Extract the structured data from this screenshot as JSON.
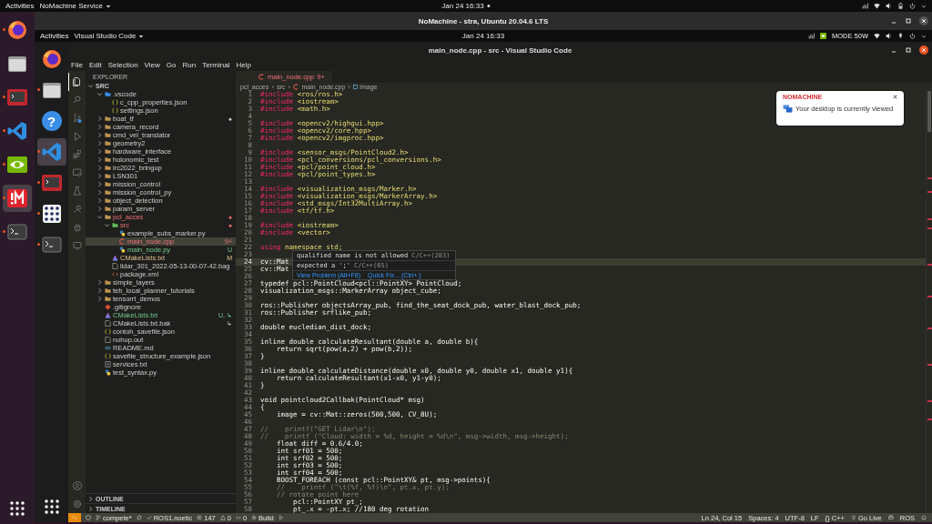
{
  "desktop": {
    "top_bar": {
      "activities": "Activities",
      "app_menu": "NoMachine Service",
      "clock": "Jan 24  16:33"
    },
    "dock": [
      {
        "kind": "browser",
        "running": true,
        "focused": false
      },
      {
        "kind": "files",
        "running": false,
        "focused": false
      },
      {
        "kind": "remote-terminal",
        "running": true,
        "focused": false
      },
      {
        "kind": "editor",
        "running": true,
        "focused": false
      },
      {
        "kind": "gpu",
        "running": true,
        "focused": false
      },
      {
        "kind": "remote",
        "running": true,
        "focused": true
      },
      {
        "kind": "terminal",
        "running": true,
        "focused": false
      }
    ],
    "apps_button": {
      "kind": "apps"
    }
  },
  "nomachine": {
    "title": "NoMachine - stra, Ubuntu 20.04.6 LTS"
  },
  "remote_desktop": {
    "top_bar": {
      "activities": "Activities",
      "app_menu": "Visual Studio Code",
      "clock": "Jan 24  16:33",
      "power_mode": "MODE 50W"
    },
    "dock": [
      {
        "kind": "browser",
        "running": false,
        "focused": false
      },
      {
        "kind": "files",
        "running": true,
        "focused": false
      },
      {
        "kind": "help",
        "glyph": "?",
        "running": false,
        "focused": false
      },
      {
        "kind": "editor",
        "running": true,
        "focused": true
      },
      {
        "kind": "remote-terminal",
        "running": true,
        "focused": false
      },
      {
        "kind": "grid",
        "running": true,
        "focused": false
      },
      {
        "kind": "terminal",
        "running": true,
        "focused": false
      }
    ],
    "apps_button": {
      "kind": "apps"
    }
  },
  "vscode": {
    "title": "main_node.cpp - src - Visual Studio Code",
    "menu": [
      "File",
      "Edit",
      "Selection",
      "View",
      "Go",
      "Run",
      "Terminal",
      "Help"
    ],
    "activity_bar": [
      {
        "kind": "files",
        "selected": true
      },
      {
        "kind": "search",
        "selected": false
      },
      {
        "kind": "source-control",
        "selected": false
      },
      {
        "kind": "run",
        "selected": false
      },
      {
        "kind": "extensions",
        "selected": false
      },
      {
        "kind": "remote",
        "selected": false
      },
      {
        "kind": "testing",
        "selected": false
      },
      {
        "kind": "deploy",
        "selected": false
      },
      {
        "kind": "ros",
        "selected": false
      },
      {
        "kind": "monitor",
        "selected": false
      }
    ],
    "activity_bottom": [
      {
        "kind": "account"
      },
      {
        "kind": "settings"
      }
    ],
    "explorer": {
      "title": "EXPLORER",
      "root": {
        "label": "SRC",
        "expanded": true
      },
      "tree": [
        {
          "label": ".vscode",
          "kind": "vscode",
          "expanded": true,
          "error": false,
          "untracked": false,
          "modified": false,
          "selected": false,
          "children": [
            {
              "label": "c_cpp_properties.json",
              "kind": "json",
              "error": false,
              "untracked": false,
              "modified": false,
              "selected": false
            },
            {
              "label": "settings.json",
              "kind": "json",
              "error": false,
              "untracked": false,
              "modified": false,
              "selected": false
            }
          ]
        },
        {
          "label": "boat_tf",
          "kind": "folder",
          "expanded": false,
          "error": false,
          "untracked": false,
          "modified": false,
          "badge": "●",
          "selected": false
        },
        {
          "label": "camera_record",
          "kind": "folder",
          "expanded": false,
          "error": false,
          "untracked": false,
          "modified": false,
          "selected": false
        },
        {
          "label": "cmd_vel_translator",
          "kind": "folder",
          "expanded": false,
          "error": false,
          "untracked": false,
          "modified": false,
          "selected": false
        },
        {
          "label": "geometry2",
          "kind": "folder",
          "expanded": false,
          "error": false,
          "untracked": false,
          "modified": false,
          "selected": false
        },
        {
          "label": "hardware_interface",
          "kind": "folder",
          "expanded": false,
          "error": false,
          "untracked": false,
          "modified": false,
          "selected": false
        },
        {
          "label": "holonomic_test",
          "kind": "folder",
          "expanded": false,
          "error": false,
          "untracked": false,
          "modified": false,
          "selected": false
        },
        {
          "label": "irc2022_bringup",
          "kind": "folder",
          "expanded": false,
          "error": false,
          "untracked": false,
          "modified": false,
          "selected": false
        },
        {
          "label": "LSN301",
          "kind": "folder",
          "expanded": false,
          "error": false,
          "untracked": false,
          "modified": false,
          "selected": false
        },
        {
          "label": "mission_control",
          "kind": "folder",
          "expanded": false,
          "error": false,
          "untracked": false,
          "modified": false,
          "selected": false
        },
        {
          "label": "mission_control_py",
          "kind": "folder",
          "expanded": false,
          "error": false,
          "untracked": false,
          "modified": false,
          "selected": false
        },
        {
          "label": "object_detection",
          "kind": "folder",
          "expanded": false,
          "error": false,
          "untracked": false,
          "modified": false,
          "selected": false
        },
        {
          "label": "param_server",
          "kind": "folder",
          "expanded": false,
          "error": false,
          "untracked": false,
          "modified": false,
          "selected": false
        },
        {
          "label": "pcl_acces",
          "kind": "folder",
          "expanded": true,
          "error": true,
          "untracked": false,
          "modified": false,
          "badge": "●",
          "selected": false,
          "children": [
            {
              "label": "src",
              "kind": "src",
              "expanded": true,
              "error": true,
              "untracked": false,
              "modified": false,
              "badge": "●",
              "selected": false,
              "children": [
                {
                  "label": "example_subs_marker.py",
                  "kind": "py",
                  "error": false,
                  "untracked": false,
                  "modified": false,
                  "selected": false
                },
                {
                  "label": "main_node.cpp",
                  "kind": "cpp",
                  "error": true,
                  "untracked": false,
                  "modified": false,
                  "badge": "9+",
                  "selected": true
                },
                {
                  "label": "main_node.py",
                  "kind": "py",
                  "error": false,
                  "untracked": true,
                  "modified": false,
                  "badge": "U",
                  "selected": false
                }
              ]
            },
            {
              "label": "CMakeLists.txt",
              "kind": "cmake",
              "error": false,
              "untracked": false,
              "modified": true,
              "badge": "M",
              "selected": false
            },
            {
              "label": "lidar_301_2022-05-13-00-07-42.bag",
              "kind": "file",
              "error": false,
              "untracked": false,
              "modified": false,
              "selected": false
            },
            {
              "label": "package.xml",
              "kind": "xml",
              "error": false,
              "untracked": false,
              "modified": false,
              "selected": false
            }
          ]
        },
        {
          "label": "simple_layers",
          "kind": "folder",
          "expanded": false,
          "error": false,
          "untracked": false,
          "modified": false,
          "selected": false
        },
        {
          "label": "teb_local_planner_tutorials",
          "kind": "folder",
          "expanded": false,
          "error": false,
          "untracked": false,
          "modified": false,
          "selected": false
        },
        {
          "label": "tensorrt_demos",
          "kind": "folder",
          "expanded": false,
          "error": false,
          "untracked": false,
          "modified": false,
          "selected": false
        },
        {
          "label": ".gitignore",
          "kind": "git",
          "error": false,
          "untracked": false,
          "modified": false,
          "selected": false
        },
        {
          "label": "CMakeLists.txt",
          "kind": "cmake",
          "error": false,
          "untracked": true,
          "modified": false,
          "badge": "U, ↳",
          "selected": false
        },
        {
          "label": "CMakeLists.txt.bak",
          "kind": "file",
          "error": false,
          "untracked": false,
          "modified": false,
          "badge": "↳",
          "selected": false
        },
        {
          "label": "contoh_savefile.json",
          "kind": "json",
          "error": false,
          "untracked": false,
          "modified": false,
          "selected": false
        },
        {
          "label": "nohup.out",
          "kind": "file",
          "error": false,
          "untracked": false,
          "modified": false,
          "selected": false
        },
        {
          "label": "README.md",
          "kind": "md",
          "error": false,
          "untracked": false,
          "modified": false,
          "selected": false
        },
        {
          "label": "savefile_structure_example.json",
          "kind": "json",
          "error": false,
          "untracked": false,
          "modified": false,
          "selected": false
        },
        {
          "label": "services.txt",
          "kind": "txt",
          "error": false,
          "untracked": false,
          "modified": false,
          "selected": false
        },
        {
          "label": "test_syntax.py",
          "kind": "py",
          "error": false,
          "untracked": false,
          "modified": false,
          "selected": false
        }
      ],
      "sections": [
        {
          "label": "OUTLINE",
          "expanded": false
        },
        {
          "label": "TIMELINE",
          "expanded": false
        }
      ]
    },
    "tabs": [
      {
        "label": "main_node.cpp",
        "badge": "9+",
        "selected": true
      }
    ],
    "breadcrumb": [
      {
        "label": "pcl_acces",
        "kind": "folder"
      },
      {
        "label": "src",
        "kind": "folder"
      },
      {
        "label": "main_node.cpp",
        "kind": "cpp"
      },
      {
        "label": "image",
        "kind": "symbol"
      }
    ],
    "lines": [
      {
        "n": "1",
        "current": false,
        "kind": "directive",
        "text": "#include <ros/ros.h>"
      },
      {
        "n": "2",
        "current": false,
        "kind": "directive",
        "text": "#include <iostream>"
      },
      {
        "n": "3",
        "current": false,
        "kind": "directive",
        "text": "#include <math.h>"
      },
      {
        "n": "4",
        "current": false
      },
      {
        "n": "5",
        "current": false,
        "kind": "directive",
        "text": "#include <opencv2/highgui.hpp>"
      },
      {
        "n": "6",
        "current": false,
        "kind": "directive",
        "text": "#include <opencv2/core.hpp>"
      },
      {
        "n": "7",
        "current": false,
        "kind": "directive",
        "text": "#include <opencv2/imgproc.hpp>"
      },
      {
        "n": "8",
        "current": false
      },
      {
        "n": "9",
        "current": false,
        "kind": "directive",
        "text": "#include <sensor_msgs/PointCloud2.h>"
      },
      {
        "n": "10",
        "current": false,
        "kind": "directive",
        "text": "#include <pcl_conversions/pcl_conversions.h>"
      },
      {
        "n": "11",
        "current": false,
        "kind": "directive",
        "text": "#include <pcl/point_cloud.h>"
      },
      {
        "n": "12",
        "current": false,
        "kind": "directive",
        "text": "#include <pcl/point_types.h>"
      },
      {
        "n": "13",
        "current": false
      },
      {
        "n": "14",
        "current": false,
        "kind": "directive",
        "text": "#include <visualization_msgs/Marker.h>"
      },
      {
        "n": "15",
        "current": false,
        "kind": "directive",
        "text": "#include <visualization_msgs/MarkerArray.h>"
      },
      {
        "n": "16",
        "current": false,
        "kind": "directive",
        "text": "#include <std_msgs/Int32MultiArray.h>"
      },
      {
        "n": "17",
        "current": false,
        "kind": "directive",
        "text": "#include <tf/tf.h>"
      },
      {
        "n": "18",
        "current": false
      },
      {
        "n": "19",
        "current": false,
        "kind": "directive",
        "text": "#include <iostream>"
      },
      {
        "n": "20",
        "current": false,
        "kind": "directive",
        "text": "#include <vector>"
      },
      {
        "n": "21",
        "current": false
      },
      {
        "n": "22",
        "current": false,
        "kind": "directive",
        "text": "using namespace std;"
      },
      {
        "n": "23",
        "current": false
      },
      {
        "n": "24",
        "current": true,
        "kind": "code",
        "text": "cv::Mat"
      },
      {
        "n": "25",
        "current": false,
        "kind": "code",
        "text": "cv::Mat"
      },
      {
        "n": "26",
        "current": false
      },
      {
        "n": "27",
        "current": false,
        "kind": "code",
        "text": "typedef pcl::PointCloud<pcl::PointXY> PointCloud;"
      },
      {
        "n": "28",
        "current": false,
        "kind": "code",
        "text": "visualization_msgs::MarkerArray object_cube;"
      },
      {
        "n": "29",
        "current": false
      },
      {
        "n": "30",
        "current": false,
        "kind": "code",
        "text": "ros::Publisher objectsArray_pub, find_the_seat_dock_pub, water_blast_dock_pub;"
      },
      {
        "n": "31",
        "current": false,
        "kind": "code",
        "text": "ros::Publisher srflike_pub;"
      },
      {
        "n": "32",
        "current": false
      },
      {
        "n": "33",
        "current": false,
        "kind": "code",
        "text": "double eucledian_dist_dock;"
      },
      {
        "n": "34",
        "current": false
      },
      {
        "n": "35",
        "current": false,
        "kind": "code",
        "text": "inline double calculateResultant(double a, double b){"
      },
      {
        "n": "36",
        "current": false,
        "kind": "code",
        "text": "    return sqrt(pow(a,2) + pow(b,2));"
      },
      {
        "n": "37",
        "current": false,
        "kind": "code",
        "text": "}"
      },
      {
        "n": "38",
        "current": false
      },
      {
        "n": "39",
        "current": false,
        "kind": "code",
        "text": "inline double calculateDistance(double x0, double y0, double x1, double y1){"
      },
      {
        "n": "40",
        "current": false,
        "kind": "code",
        "text": "    return calculateResultant(x1-x0, y1-y0);"
      },
      {
        "n": "41",
        "current": false,
        "kind": "code",
        "text": "}"
      },
      {
        "n": "42",
        "current": false
      },
      {
        "n": "43",
        "current": false,
        "kind": "code",
        "text": "void pointcloud2Callbak(PointCloud* msg)"
      },
      {
        "n": "44",
        "current": false,
        "kind": "code",
        "text": "{"
      },
      {
        "n": "45",
        "current": false,
        "kind": "code",
        "text": "    image = cv::Mat::zeros(500,500, CV_8U);"
      },
      {
        "n": "46",
        "current": false
      },
      {
        "n": "47",
        "current": false,
        "kind": "comment",
        "text": "//    printf(\"GET Lidar\\n\");"
      },
      {
        "n": "48",
        "current": false,
        "kind": "comment",
        "text": "//    printf (\"Cloud: width = %d, height = %d\\n\", msg->width, msg->height);"
      },
      {
        "n": "49",
        "current": false,
        "kind": "code",
        "text": "    float diff = 0.6/4.0;"
      },
      {
        "n": "50",
        "current": false,
        "kind": "code",
        "text": "    int srf01 = 500;"
      },
      {
        "n": "51",
        "current": false,
        "kind": "code",
        "text": "    int srf02 = 500;"
      },
      {
        "n": "52",
        "current": false,
        "kind": "code",
        "text": "    int srf03 = 500;"
      },
      {
        "n": "53",
        "current": false,
        "kind": "code",
        "text": "    int srf04 = 500;"
      },
      {
        "n": "54",
        "current": false,
        "kind": "code",
        "text": "    BOOST_FOREACH (const pcl::PointXY& pt, msg->points){"
      },
      {
        "n": "55",
        "current": false,
        "kind": "comment",
        "text": "    //    printf (\"\\t(%f, %f)\\n\", pt.x, pt.y);"
      },
      {
        "n": "56",
        "current": false,
        "kind": "comment",
        "text": "    // rotate point here"
      },
      {
        "n": "57",
        "current": false,
        "kind": "code",
        "text": "        pcl::PointXY pt_;"
      },
      {
        "n": "58",
        "current": false,
        "kind": "code",
        "text": "        pt_.x = -pt.x; //180 deg rotation"
      }
    ],
    "hover": {
      "problems": [
        {
          "message": "qualified name is not allowed",
          "source": "C/C++(283)"
        },
        {
          "message": "expected a ';'",
          "source": "C/C++(65)"
        }
      ],
      "actions": [
        "View Problem (Alt+F8)",
        "Quick Fix... (Ctrl+.)"
      ]
    }
  },
  "notification": {
    "brand": "NOMACHINE",
    "message": "Your desktop is currently viewed"
  },
  "status_bar": {
    "left": [
      {
        "kind": "remote"
      },
      {
        "kind": "shield"
      },
      {
        "kind": "branch",
        "text": "compete*"
      },
      {
        "kind": "sync"
      },
      {
        "kind": "check",
        "text": "ROS1.noetic"
      },
      {
        "kind": "errors",
        "text": "147"
      },
      {
        "kind": "warnings",
        "text": "0"
      },
      {
        "kind": "broadcast",
        "text": "0"
      },
      {
        "kind": "gear",
        "text": "Build"
      },
      {
        "kind": "play"
      }
    ],
    "right": [
      {
        "kind": "text",
        "text": "Ln 24, Col 15"
      },
      {
        "kind": "text",
        "text": "Spaces: 4"
      },
      {
        "kind": "text",
        "text": "UTF-8"
      },
      {
        "kind": "text",
        "text": "LF"
      },
      {
        "kind": "text",
        "text": "{} C++"
      },
      {
        "kind": "live",
        "text": "Go Live"
      },
      {
        "kind": "printer"
      },
      {
        "kind": "text",
        "text": "ROS"
      },
      {
        "kind": "bell"
      }
    ]
  }
}
